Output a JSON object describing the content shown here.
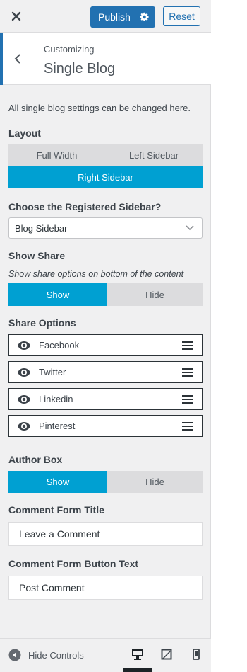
{
  "topbar": {
    "publish_label": "Publish",
    "reset_label": "Reset"
  },
  "section": {
    "breadcrumb": "Customizing",
    "title": "Single Blog"
  },
  "body": {
    "description": "All single blog settings can be changed here.",
    "layout": {
      "label": "Layout",
      "options": [
        "Full Width",
        "Left Sidebar",
        "Right Sidebar"
      ],
      "selected": "Right Sidebar"
    },
    "sidebar": {
      "label": "Choose the Registered Sidebar?",
      "value": "Blog Sidebar"
    },
    "show_share": {
      "label": "Show Share",
      "description": "Show share options on bottom of the content",
      "options": [
        "Show",
        "Hide"
      ],
      "selected": "Show"
    },
    "share_options": {
      "label": "Share Options",
      "items": [
        "Facebook",
        "Twitter",
        "Linkedin",
        "Pinterest"
      ]
    },
    "author_box": {
      "label": "Author Box",
      "options": [
        "Show",
        "Hide"
      ],
      "selected": "Show"
    },
    "comment_title": {
      "label": "Comment Form Title",
      "value": "Leave a Comment"
    },
    "comment_button": {
      "label": "Comment Form Button Text",
      "value": "Post Comment"
    }
  },
  "footer": {
    "hide_controls_label": "Hide Controls",
    "devices": [
      "desktop",
      "tablet",
      "mobile"
    ],
    "active_device": "desktop"
  },
  "colors": {
    "primary": "#2271b1",
    "active_segment": "#00a0d2",
    "panel_bg": "#f0f0f1"
  },
  "icons": [
    "close-icon",
    "gear-icon",
    "chevron-left-icon",
    "chevron-down-icon",
    "eye-icon",
    "drag-handle-icon",
    "arrow-left-circle-icon",
    "desktop-icon",
    "tablet-icon",
    "mobile-icon"
  ]
}
